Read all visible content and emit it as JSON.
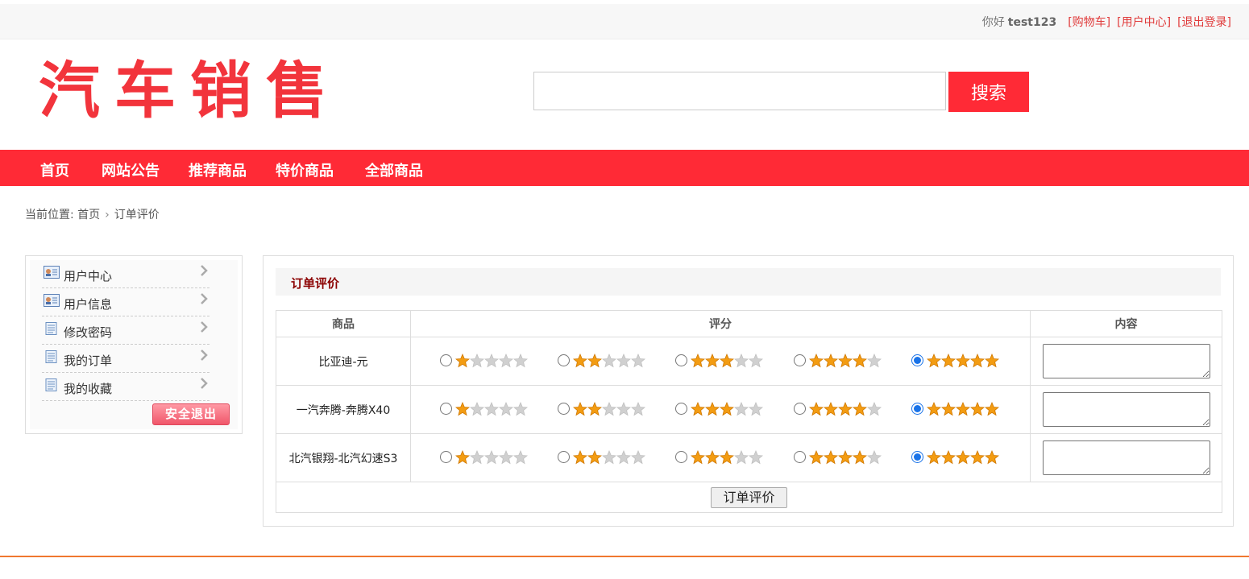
{
  "topbar": {
    "greeting": "你好",
    "username": "test123",
    "cart_link": "[购物车]",
    "user_center_link": "[用户中心]",
    "logout_link": "[退出登录]"
  },
  "header": {
    "logo_text": "汽车销售",
    "search_placeholder": "",
    "search_button": "搜索"
  },
  "nav": {
    "items": [
      "首页",
      "网站公告",
      "推荐商品",
      "特价商品",
      "全部商品"
    ]
  },
  "breadcrumb": {
    "prefix": "当前位置:",
    "home": "首页",
    "current": "订单评价"
  },
  "sidebar": {
    "items": [
      {
        "label": "用户中心",
        "icon": "id-card-icon"
      },
      {
        "label": "用户信息",
        "icon": "id-card-icon"
      },
      {
        "label": "修改密码",
        "icon": "document-icon"
      },
      {
        "label": "我的订单",
        "icon": "document-icon"
      },
      {
        "label": "我的收藏",
        "icon": "document-icon"
      }
    ],
    "logout_button": "安全退出"
  },
  "panel": {
    "title": "订单评价",
    "columns": [
      "商品",
      "评分",
      "内容"
    ],
    "rows": [
      {
        "product": "比亚迪-元",
        "selected_rating": 5,
        "content": ""
      },
      {
        "product": "一汽奔腾-奔腾X40",
        "selected_rating": 5,
        "content": ""
      },
      {
        "product": "北汽银翔-北汽幻速S3",
        "selected_rating": 5,
        "content": ""
      }
    ],
    "submit_button": "订单评价"
  },
  "colors": {
    "brand_red": "#ff2a36",
    "link_red": "#e03a3a",
    "title_dark_red": "#8b0000",
    "star_orange": "#f39c12",
    "star_gray": "#d0d0d0",
    "footer_orange": "#f07830"
  }
}
